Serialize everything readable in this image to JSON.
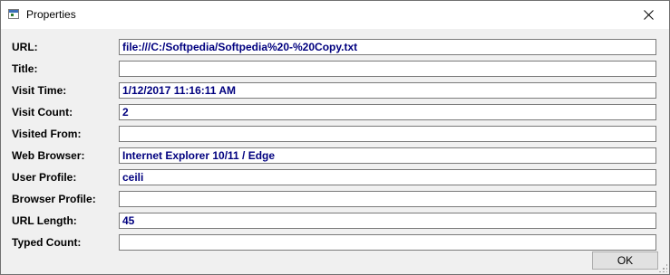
{
  "window": {
    "title": "Properties",
    "close_label": "×"
  },
  "fields": [
    {
      "label": "URL:",
      "value": "file:///C:/Softpedia/Softpedia%20-%20Copy.txt"
    },
    {
      "label": "Title:",
      "value": ""
    },
    {
      "label": "Visit Time:",
      "value": "1/12/2017 11:16:11 AM"
    },
    {
      "label": "Visit Count:",
      "value": "2"
    },
    {
      "label": "Visited From:",
      "value": ""
    },
    {
      "label": "Web Browser:",
      "value": "Internet Explorer 10/11 / Edge"
    },
    {
      "label": "User Profile:",
      "value": "ceili"
    },
    {
      "label": "Browser Profile:",
      "value": ""
    },
    {
      "label": "URL Length:",
      "value": "45"
    },
    {
      "label": "Typed Count:",
      "value": ""
    }
  ],
  "buttons": {
    "ok_label": "OK"
  },
  "colors": {
    "value_text": "#00007f",
    "window_bg": "#f0f0f0",
    "titlebar_bg": "#ffffff"
  },
  "icons": {
    "app": "properties-window-icon",
    "close": "close-icon"
  }
}
